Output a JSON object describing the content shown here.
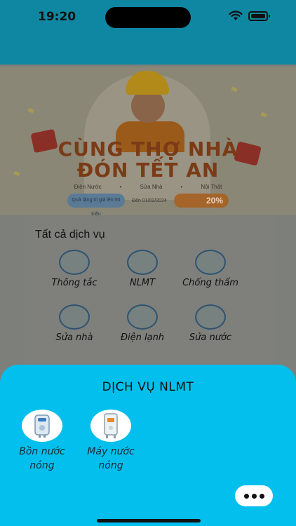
{
  "status_bar": {
    "time": "19:20"
  },
  "banner": {
    "title_line1": "CÙNG THỢ NHÀ",
    "title_line2": "ĐÓN TẾT AN",
    "tags": [
      "Điện Nước",
      "Sửa Nhà",
      "Nội Thất"
    ],
    "promo_small": "Quà tặng trị giá lên 50 triệu",
    "promo_date": "Đến 01/02/2024",
    "promo_percent": "20%"
  },
  "services": {
    "section_title": "Tất cả dịch vụ",
    "items": [
      {
        "label": "Thông tắc",
        "icon": "plunger-icon"
      },
      {
        "label": "NLMT",
        "icon": "solar-panel-icon"
      },
      {
        "label": "Chống thấm",
        "icon": "waterproof-roof-icon"
      },
      {
        "label": "Sửa nhà",
        "icon": "house-repair-icon"
      },
      {
        "label": "Điện lạnh",
        "icon": "air-conditioner-icon"
      },
      {
        "label": "Sửa nước",
        "icon": "faucet-icon"
      }
    ]
  },
  "sheet": {
    "title": "DỊCH VỤ NLMT",
    "options": [
      {
        "label_line1": "Bồn nước",
        "label_line2": "nóng",
        "icon": "water-tank-icon"
      },
      {
        "label_line1": "Máy nước",
        "label_line2": "nóng",
        "icon": "water-heater-icon"
      }
    ],
    "more_icon": "more-dots-icon"
  },
  "colors": {
    "sheet_bg": "#03bfed",
    "header_bg": "#0f87a2"
  }
}
